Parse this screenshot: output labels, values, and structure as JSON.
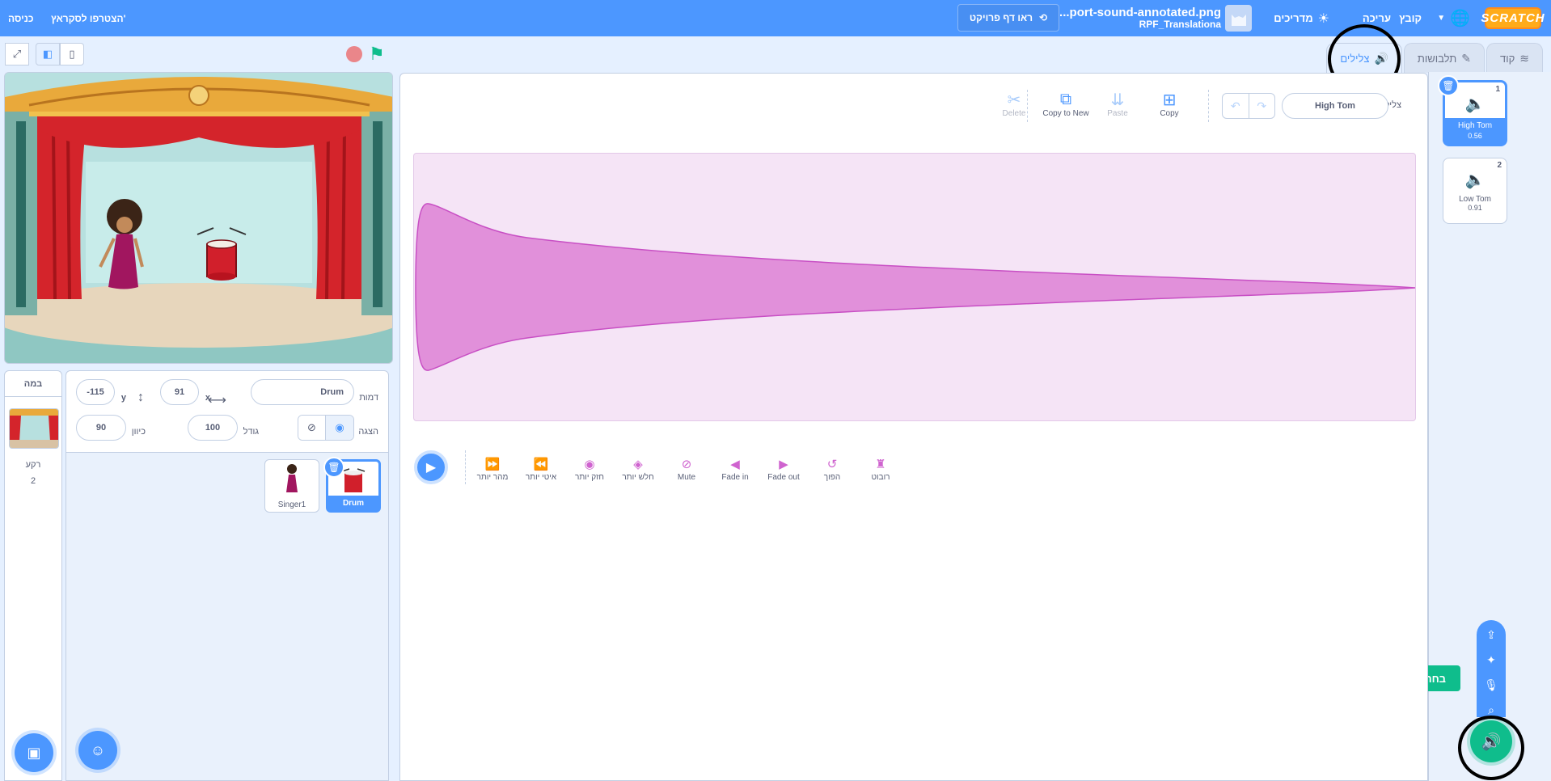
{
  "menubar": {
    "logo": "SCRATCH",
    "file": "קובץ",
    "edit": "עריכה",
    "tutorials": "מדריכים",
    "project_title": "...port-sound-annotated.png",
    "project_author": "RPF_Translationa",
    "see_project_page": "ראו דף פרויקט",
    "join": "הצטרפו לסקראץ'",
    "sign_in": "כניסה"
  },
  "tabs": {
    "code": "קוד",
    "costumes": "תלבושות",
    "sounds": "צלילים"
  },
  "sounds": [
    {
      "num": "1",
      "name": "High Tom",
      "duration": "0.56",
      "selected": true
    },
    {
      "num": "2",
      "name": "Low Tom",
      "duration": "0.91",
      "selected": false
    }
  ],
  "choose_sound_tooltip": "בחרו צליל",
  "editor": {
    "sound_label": "צליל",
    "sound_name": "High Tom",
    "tools": {
      "copy": "Copy",
      "paste": "Paste",
      "copy_to_new": "Copy to New",
      "delete": "Delete"
    },
    "effects": {
      "faster": "מהר יותר",
      "slower": "איטי יותר",
      "louder": "חזק יותר",
      "softer": "חלש יותר",
      "mute": "Mute",
      "fade_in": "Fade in",
      "fade_out": "Fade out",
      "reverse": "הפוך",
      "robot": "רובוט"
    }
  },
  "sprite_info": {
    "sprite_label": "דמות",
    "sprite_name": "Drum",
    "x_label": "x",
    "x_value": "91",
    "y_label": "y",
    "y_value": "-115",
    "show_label": "הצגה",
    "size_label": "גודל",
    "size_value": "100",
    "direction_label": "כיוון",
    "direction_value": "90"
  },
  "sprites": [
    {
      "name": "Drum",
      "selected": true
    },
    {
      "name": "Singer1",
      "selected": false
    }
  ],
  "stage_panel": {
    "title": "במה",
    "backdrops_label": "רקע",
    "backdrops_count": "2"
  },
  "colors": {
    "accent": "#4c97ff",
    "sound_wave": "#cf63cf",
    "add_sound": "#0fbd8c"
  }
}
